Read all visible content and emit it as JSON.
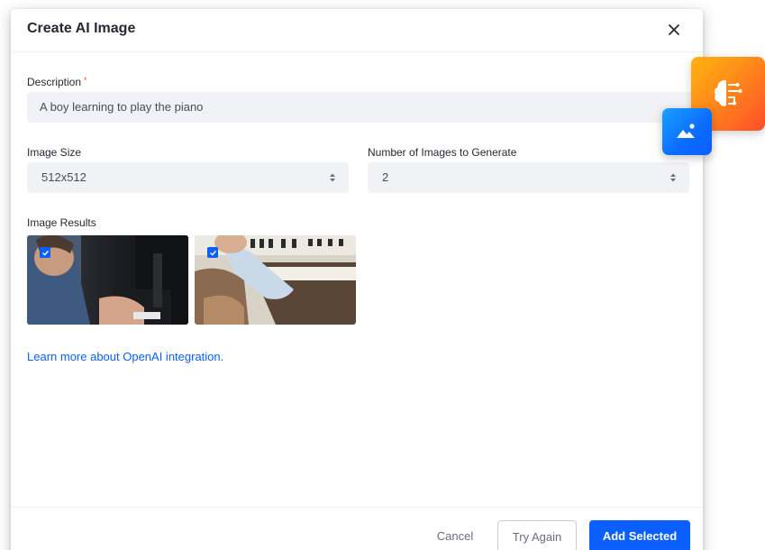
{
  "dialog": {
    "title": "Create AI Image",
    "close_icon": "close-icon"
  },
  "description": {
    "label": "Description",
    "required_marker": "*",
    "value": "A boy learning to play the piano"
  },
  "image_size": {
    "label": "Image Size",
    "value": "512x512"
  },
  "image_count": {
    "label": "Number of Images to Generate",
    "value": "2"
  },
  "results": {
    "label": "Image Results",
    "images": [
      {
        "selected": true
      },
      {
        "selected": true
      }
    ]
  },
  "learn_link": "Learn more about OpenAI integration.",
  "footer": {
    "cancel_label": "Cancel",
    "try_again_label": "Try Again",
    "add_selected_label": "Add Selected"
  },
  "colors": {
    "accent": "#0b5fff",
    "required": "#da5a1f",
    "ai_badge": "#ff8a1a",
    "image_badge": "#0b6bff"
  },
  "icons": {
    "ai_badge": "ai-brain-icon",
    "image_badge": "image-icon",
    "select_arrows": "select-arrows-icon",
    "check": "checkbox-checked-icon"
  }
}
